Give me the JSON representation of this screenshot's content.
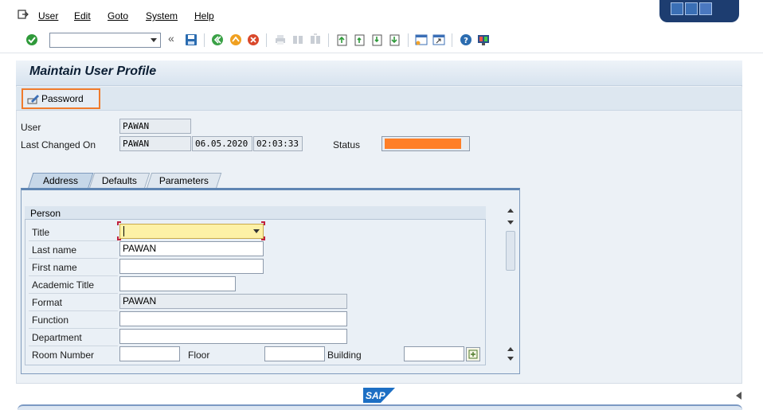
{
  "menubar": {
    "items": [
      "User",
      "Edit",
      "Goto",
      "System",
      "Help"
    ]
  },
  "toolbar": {
    "command_field_value": "",
    "collapse_glyph": "«"
  },
  "page": {
    "title": "Maintain User Profile"
  },
  "app_toolbar": {
    "password_button": "Password"
  },
  "header_fields": {
    "user_label": "User",
    "user_value": "PAWAN",
    "last_changed_label": "Last Changed On",
    "last_changed_by": "PAWAN",
    "last_changed_date": "06.05.2020",
    "last_changed_time": "02:03:33",
    "status_label": "Status",
    "status_color": "#ff7f27"
  },
  "tabs": [
    "Address",
    "Defaults",
    "Parameters"
  ],
  "person": {
    "group_title": "Person",
    "title_label": "Title",
    "title_value": "",
    "last_name_label": "Last name",
    "last_name_value": "PAWAN",
    "first_name_label": "First name",
    "first_name_value": "",
    "academic_title_label": "Academic Title",
    "academic_title_value": "",
    "format_label": "Format",
    "format_value": "PAWAN",
    "function_label": "Function",
    "function_value": "",
    "department_label": "Department",
    "department_value": "",
    "room_number_label": "Room Number",
    "room_number_value": "",
    "floor_label": "Floor",
    "floor_value": "",
    "building_label": "Building",
    "building_value": ""
  },
  "footer": {
    "logo_text": "SAP"
  },
  "colors": {
    "accent": "#f07b2c",
    "sap_blue": "#1d6fc4"
  }
}
